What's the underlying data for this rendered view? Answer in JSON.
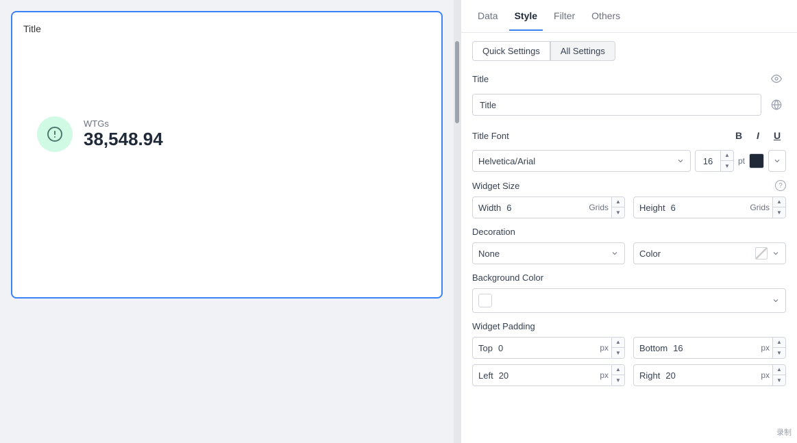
{
  "tabs": [
    {
      "id": "data",
      "label": "Data",
      "active": false
    },
    {
      "id": "style",
      "label": "Style",
      "active": true
    },
    {
      "id": "filter",
      "label": "Filter",
      "active": false
    },
    {
      "id": "others",
      "label": "Others",
      "active": false
    }
  ],
  "settings": {
    "quick_label": "Quick Settings",
    "all_label": "All Settings"
  },
  "title_section": {
    "label": "Title",
    "value": "Title"
  },
  "font_section": {
    "label": "Title Font",
    "font": "Helvetica/Arial",
    "size": "16",
    "unit": "pt"
  },
  "widget_size": {
    "label": "Widget Size",
    "width_label": "Width",
    "width_value": "6",
    "width_unit": "Grids",
    "height_label": "Height",
    "height_value": "6",
    "height_unit": "Grids"
  },
  "decoration": {
    "label": "Decoration",
    "value": "None",
    "color_label": "Color"
  },
  "background_color": {
    "label": "Background Color"
  },
  "widget_padding": {
    "label": "Widget Padding",
    "top_label": "Top",
    "top_value": "0",
    "top_unit": "px",
    "bottom_label": "Bottom",
    "bottom_value": "16",
    "bottom_unit": "px",
    "left_label": "Left",
    "left_value": "20",
    "left_unit": "px",
    "right_label": "Right",
    "right_value": "20",
    "right_unit": "px"
  },
  "widget": {
    "title": "Title",
    "label": "WTGs",
    "value": "38,548.94"
  }
}
